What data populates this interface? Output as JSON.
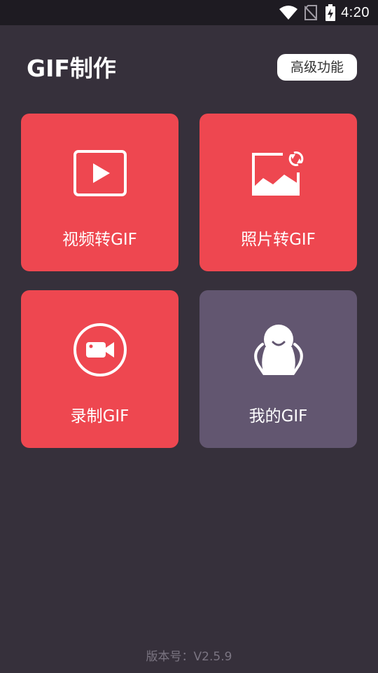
{
  "status_bar": {
    "time": "4:20",
    "icons": [
      "wifi-icon",
      "no-sim-icon",
      "battery-charging-icon"
    ]
  },
  "header": {
    "title": "GIF制作",
    "advanced_button_label": "高级功能"
  },
  "tiles": [
    {
      "label": "视频转GIF",
      "icon": "video-play-icon",
      "color": "#ee4750"
    },
    {
      "label": "照片转GIF",
      "icon": "photo-convert-icon",
      "color": "#ee4750"
    },
    {
      "label": "录制GIF",
      "icon": "record-camera-icon",
      "color": "#ee4750"
    },
    {
      "label": "我的GIF",
      "icon": "mascot-icon",
      "color": "#625670"
    }
  ],
  "footer": {
    "version": "版本号：V2.5.9"
  },
  "colors": {
    "background": "#36303b",
    "status_bar": "#1e1b22",
    "accent": "#ee4750",
    "secondary_tile": "#625670"
  }
}
